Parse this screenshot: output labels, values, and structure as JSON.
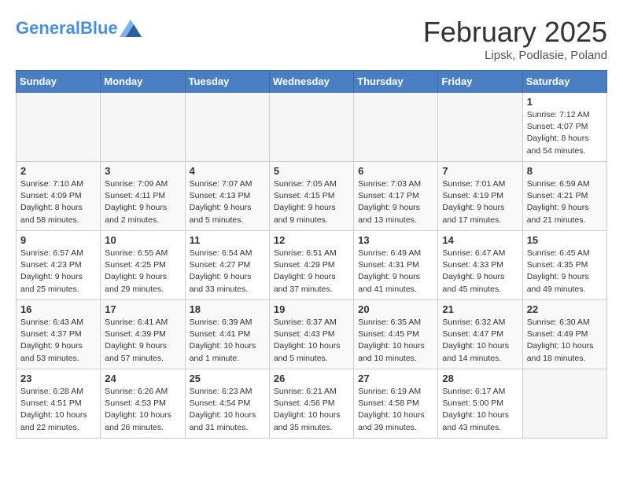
{
  "header": {
    "logo_general": "General",
    "logo_blue": "Blue",
    "month_title": "February 2025",
    "location": "Lipsk, Podlasie, Poland"
  },
  "weekdays": [
    "Sunday",
    "Monday",
    "Tuesday",
    "Wednesday",
    "Thursday",
    "Friday",
    "Saturday"
  ],
  "weeks": [
    [
      {
        "day": "",
        "info": ""
      },
      {
        "day": "",
        "info": ""
      },
      {
        "day": "",
        "info": ""
      },
      {
        "day": "",
        "info": ""
      },
      {
        "day": "",
        "info": ""
      },
      {
        "day": "",
        "info": ""
      },
      {
        "day": "1",
        "info": "Sunrise: 7:12 AM\nSunset: 4:07 PM\nDaylight: 8 hours and 54 minutes."
      }
    ],
    [
      {
        "day": "2",
        "info": "Sunrise: 7:10 AM\nSunset: 4:09 PM\nDaylight: 8 hours and 58 minutes."
      },
      {
        "day": "3",
        "info": "Sunrise: 7:09 AM\nSunset: 4:11 PM\nDaylight: 9 hours and 2 minutes."
      },
      {
        "day": "4",
        "info": "Sunrise: 7:07 AM\nSunset: 4:13 PM\nDaylight: 9 hours and 5 minutes."
      },
      {
        "day": "5",
        "info": "Sunrise: 7:05 AM\nSunset: 4:15 PM\nDaylight: 9 hours and 9 minutes."
      },
      {
        "day": "6",
        "info": "Sunrise: 7:03 AM\nSunset: 4:17 PM\nDaylight: 9 hours and 13 minutes."
      },
      {
        "day": "7",
        "info": "Sunrise: 7:01 AM\nSunset: 4:19 PM\nDaylight: 9 hours and 17 minutes."
      },
      {
        "day": "8",
        "info": "Sunrise: 6:59 AM\nSunset: 4:21 PM\nDaylight: 9 hours and 21 minutes."
      }
    ],
    [
      {
        "day": "9",
        "info": "Sunrise: 6:57 AM\nSunset: 4:23 PM\nDaylight: 9 hours and 25 minutes."
      },
      {
        "day": "10",
        "info": "Sunrise: 6:55 AM\nSunset: 4:25 PM\nDaylight: 9 hours and 29 minutes."
      },
      {
        "day": "11",
        "info": "Sunrise: 6:54 AM\nSunset: 4:27 PM\nDaylight: 9 hours and 33 minutes."
      },
      {
        "day": "12",
        "info": "Sunrise: 6:51 AM\nSunset: 4:29 PM\nDaylight: 9 hours and 37 minutes."
      },
      {
        "day": "13",
        "info": "Sunrise: 6:49 AM\nSunset: 4:31 PM\nDaylight: 9 hours and 41 minutes."
      },
      {
        "day": "14",
        "info": "Sunrise: 6:47 AM\nSunset: 4:33 PM\nDaylight: 9 hours and 45 minutes."
      },
      {
        "day": "15",
        "info": "Sunrise: 6:45 AM\nSunset: 4:35 PM\nDaylight: 9 hours and 49 minutes."
      }
    ],
    [
      {
        "day": "16",
        "info": "Sunrise: 6:43 AM\nSunset: 4:37 PM\nDaylight: 9 hours and 53 minutes."
      },
      {
        "day": "17",
        "info": "Sunrise: 6:41 AM\nSunset: 4:39 PM\nDaylight: 9 hours and 57 minutes."
      },
      {
        "day": "18",
        "info": "Sunrise: 6:39 AM\nSunset: 4:41 PM\nDaylight: 10 hours and 1 minute."
      },
      {
        "day": "19",
        "info": "Sunrise: 6:37 AM\nSunset: 4:43 PM\nDaylight: 10 hours and 5 minutes."
      },
      {
        "day": "20",
        "info": "Sunrise: 6:35 AM\nSunset: 4:45 PM\nDaylight: 10 hours and 10 minutes."
      },
      {
        "day": "21",
        "info": "Sunrise: 6:32 AM\nSunset: 4:47 PM\nDaylight: 10 hours and 14 minutes."
      },
      {
        "day": "22",
        "info": "Sunrise: 6:30 AM\nSunset: 4:49 PM\nDaylight: 10 hours and 18 minutes."
      }
    ],
    [
      {
        "day": "23",
        "info": "Sunrise: 6:28 AM\nSunset: 4:51 PM\nDaylight: 10 hours and 22 minutes."
      },
      {
        "day": "24",
        "info": "Sunrise: 6:26 AM\nSunset: 4:53 PM\nDaylight: 10 hours and 26 minutes."
      },
      {
        "day": "25",
        "info": "Sunrise: 6:23 AM\nSunset: 4:54 PM\nDaylight: 10 hours and 31 minutes."
      },
      {
        "day": "26",
        "info": "Sunrise: 6:21 AM\nSunset: 4:56 PM\nDaylight: 10 hours and 35 minutes."
      },
      {
        "day": "27",
        "info": "Sunrise: 6:19 AM\nSunset: 4:58 PM\nDaylight: 10 hours and 39 minutes."
      },
      {
        "day": "28",
        "info": "Sunrise: 6:17 AM\nSunset: 5:00 PM\nDaylight: 10 hours and 43 minutes."
      },
      {
        "day": "",
        "info": ""
      }
    ]
  ]
}
